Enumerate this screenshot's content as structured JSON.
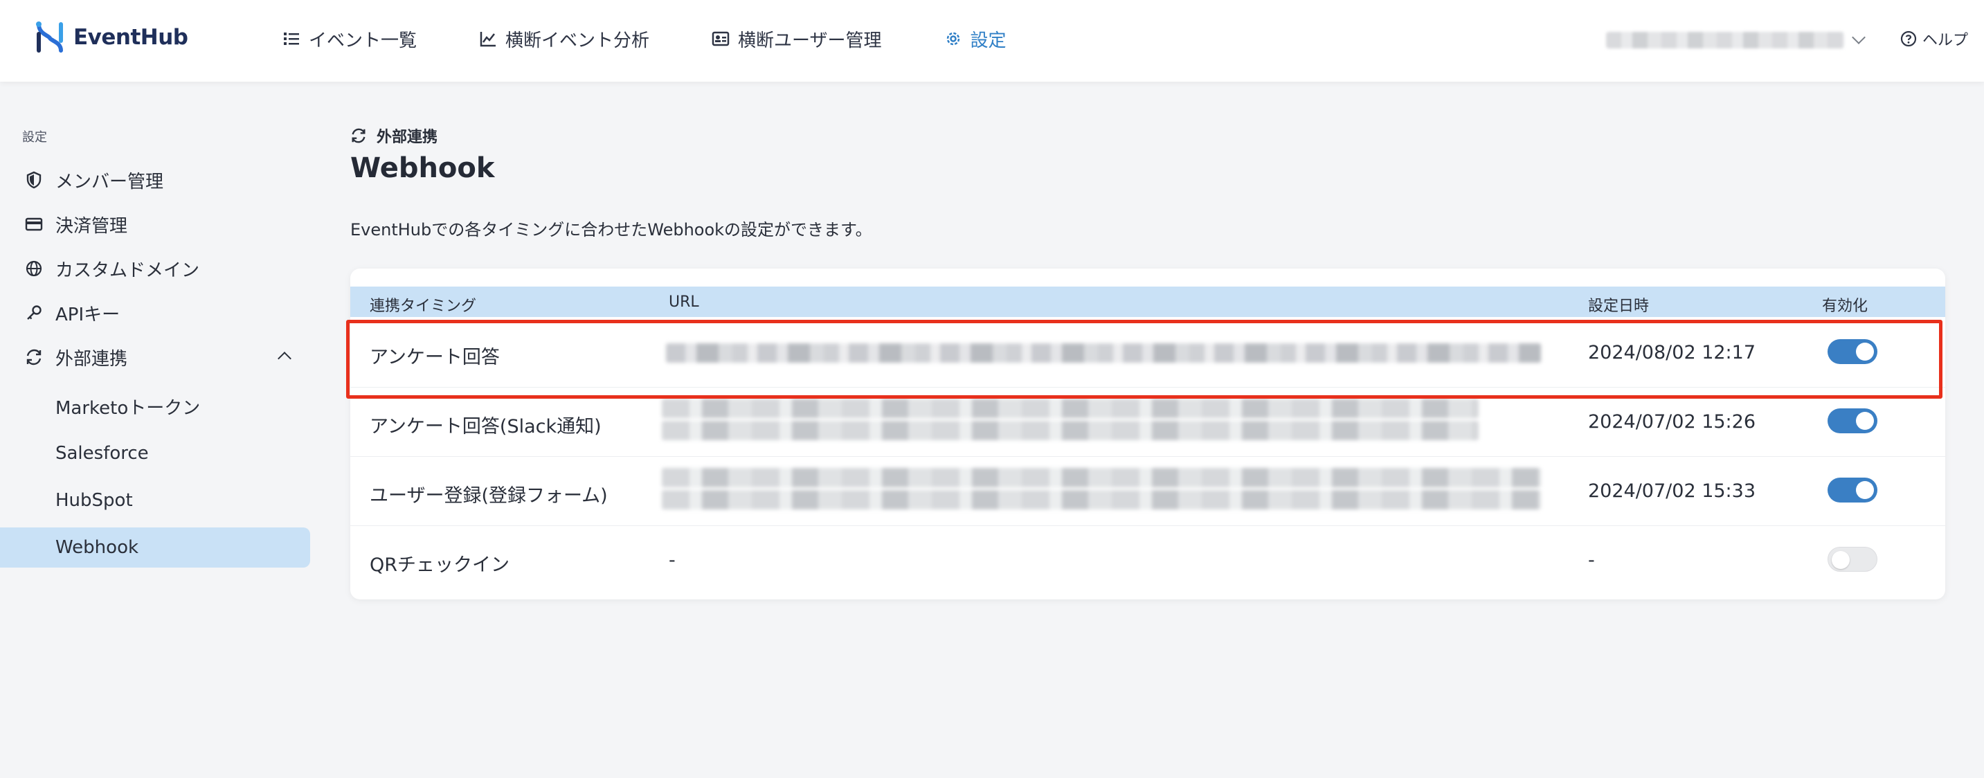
{
  "app": {
    "name": "EventHub",
    "brand_color": "#1f2f5a",
    "accent_color": "#2f7fc6"
  },
  "nav": {
    "items": [
      {
        "label": "イベント一覧",
        "icon": "list-icon"
      },
      {
        "label": "横断イベント分析",
        "icon": "chart-line-icon"
      },
      {
        "label": "横断ユーザー管理",
        "icon": "id-card-icon"
      },
      {
        "label": "設定",
        "icon": "gear-icon",
        "active": true
      }
    ],
    "help_label": "ヘルプ"
  },
  "sidebar": {
    "section_label": "設定",
    "items": [
      {
        "label": "メンバー管理",
        "icon": "shield-icon"
      },
      {
        "label": "決済管理",
        "icon": "credit-card-icon"
      },
      {
        "label": "カスタムドメイン",
        "icon": "globe-icon"
      },
      {
        "label": "APIキー",
        "icon": "key-icon"
      },
      {
        "label": "外部連携",
        "icon": "sync-icon",
        "expanded": true
      }
    ],
    "sub_items": [
      {
        "label": "Marketoトークン"
      },
      {
        "label": "Salesforce"
      },
      {
        "label": "HubSpot"
      },
      {
        "label": "Webhook",
        "selected": true
      }
    ]
  },
  "main": {
    "breadcrumb": "外部連携",
    "title": "Webhook",
    "description": "EventHubでの各タイミングに合わせたWebhookの設定ができます。",
    "table": {
      "headers": {
        "timing": "連携タイミング",
        "url": "URL",
        "date": "設定日時",
        "enabled": "有効化"
      },
      "rows": [
        {
          "timing": "アンケート回答",
          "url": "",
          "date": "2024/08/02 12:17",
          "enabled": true
        },
        {
          "timing": "アンケート回答(Slack通知)",
          "url": "",
          "date": "2024/07/02 15:26",
          "enabled": true
        },
        {
          "timing": "ユーザー登録(登録フォーム)",
          "url": "",
          "date": "2024/07/02 15:33",
          "enabled": true
        },
        {
          "timing": "QRチェックイン",
          "url": "-",
          "date": "-",
          "enabled": false
        }
      ]
    }
  }
}
